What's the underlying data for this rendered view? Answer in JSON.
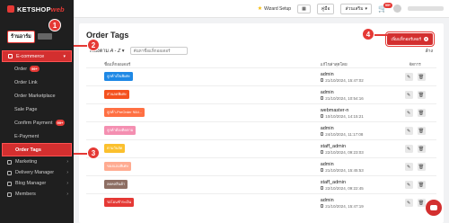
{
  "brand": {
    "name": "KETSHOP",
    "name_suffix": "web"
  },
  "account": {
    "name": "ร้านอาร์ม"
  },
  "sidebar": {
    "ecommerce": "E-commerce",
    "sub_items": [
      {
        "label": "Order",
        "badge": "99+"
      },
      {
        "label": "Order Link",
        "badge": ""
      },
      {
        "label": "Order Marketplace",
        "badge": ""
      },
      {
        "label": "Sale Page",
        "badge": ""
      },
      {
        "label": "Confirm Payment",
        "badge": "99+"
      },
      {
        "label": "E-Payment",
        "badge": ""
      },
      {
        "label": "Order Tags",
        "badge": ""
      }
    ],
    "lower_items": [
      {
        "label": "Marketing"
      },
      {
        "label": "Delivery Manager"
      },
      {
        "label": "Blog Manager"
      },
      {
        "label": "Members"
      }
    ]
  },
  "topbar": {
    "wizard": "Wizard Setup",
    "box1": "▦",
    "box2": "คู่มือ",
    "lang": "ส่วนเสริม",
    "cart_badge": "99+"
  },
  "page": {
    "title": "Order Tags",
    "add_button": "เพิ่มแท็กออร์เดอร์",
    "sort_label_prefix": "เรียงตาม",
    "sort_label_value": "A - Z",
    "search_placeholder": "ค้นหาชื่อแท็กออเดอร์",
    "clear_button": "ล้าง",
    "col_name": "ชื่อแท็กออเดอร์",
    "col_by": "แก้ไขล่าสุดโดย",
    "col_action": "จัดการ"
  },
  "rows": [
    {
      "tag": "ลูกค้าเป็นพิเศษ",
      "color": "#1e88e5",
      "by": "admin",
      "date": "21/10/2024, 15:47:02"
    },
    {
      "tag": "ส่วนลดพิเศษ",
      "color": "#f4511e",
      "by": "admin",
      "date": "21/10/2024, 10:54:16"
    },
    {
      "tag": "ลูกค้า-PreOrder ของ...",
      "color": "#ff7043",
      "by": "webmaster-n",
      "date": "10/10/2024, 14:15:21"
    },
    {
      "tag": "ลูกค้าต้องติดตาม",
      "color": "#f48fb1",
      "by": "admin",
      "date": "24/10/2024, 11:17:08"
    },
    {
      "tag": "ตามวันจัด",
      "color": "#fbc02d",
      "by": "staff_admin",
      "date": "22/10/2024, 09:23:03"
    },
    {
      "tag": "ของแถมพิเศษ",
      "color": "#ffab91",
      "by": "admin",
      "date": "21/10/2024, 15:45:53"
    },
    {
      "tag": "ลดคลสินค้า",
      "color": "#8d6e63",
      "by": "staff_admin",
      "date": "22/10/2024, 09:22:45"
    },
    {
      "tag": "รอโอนชำระเงิน",
      "color": "#e53935",
      "by": "admin",
      "date": "21/10/2024, 15:47:19"
    }
  ],
  "callouts": [
    "1",
    "2",
    "3",
    "4"
  ],
  "colors": {
    "accent": "#d32f2f",
    "sidebar_bg": "#1f1f1f",
    "highlight": "#e53935"
  }
}
